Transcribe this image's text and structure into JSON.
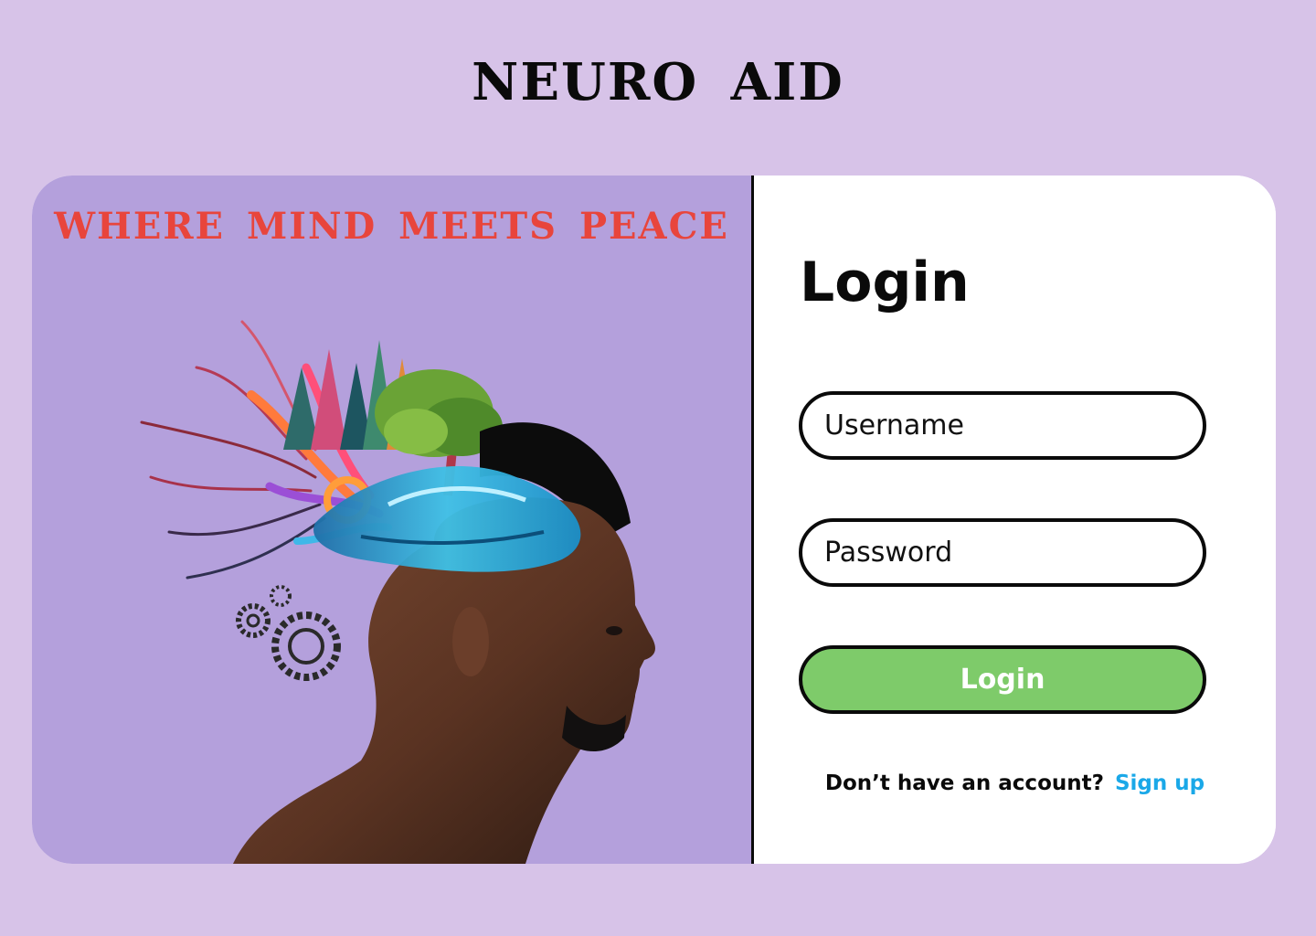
{
  "app": {
    "title": "NEURO AID"
  },
  "hero": {
    "tagline": "WHERE MIND MEETS PEACE",
    "image_icon": "profile-head-with-nature-illustration"
  },
  "login": {
    "heading": "Login",
    "username_placeholder": "Username",
    "username_value": "",
    "password_placeholder": "Password",
    "password_value": "",
    "button_label": "Login",
    "signup_prompt": "Don’t have an account?",
    "signup_link": "Sign up"
  },
  "colors": {
    "page_background": "#d7c3e8",
    "hero_background": "#b4a0dc",
    "tagline": "#e8453c",
    "login_button": "#7ecb6a",
    "signup_link": "#1aa8e8",
    "border": "#0a0a0a"
  }
}
